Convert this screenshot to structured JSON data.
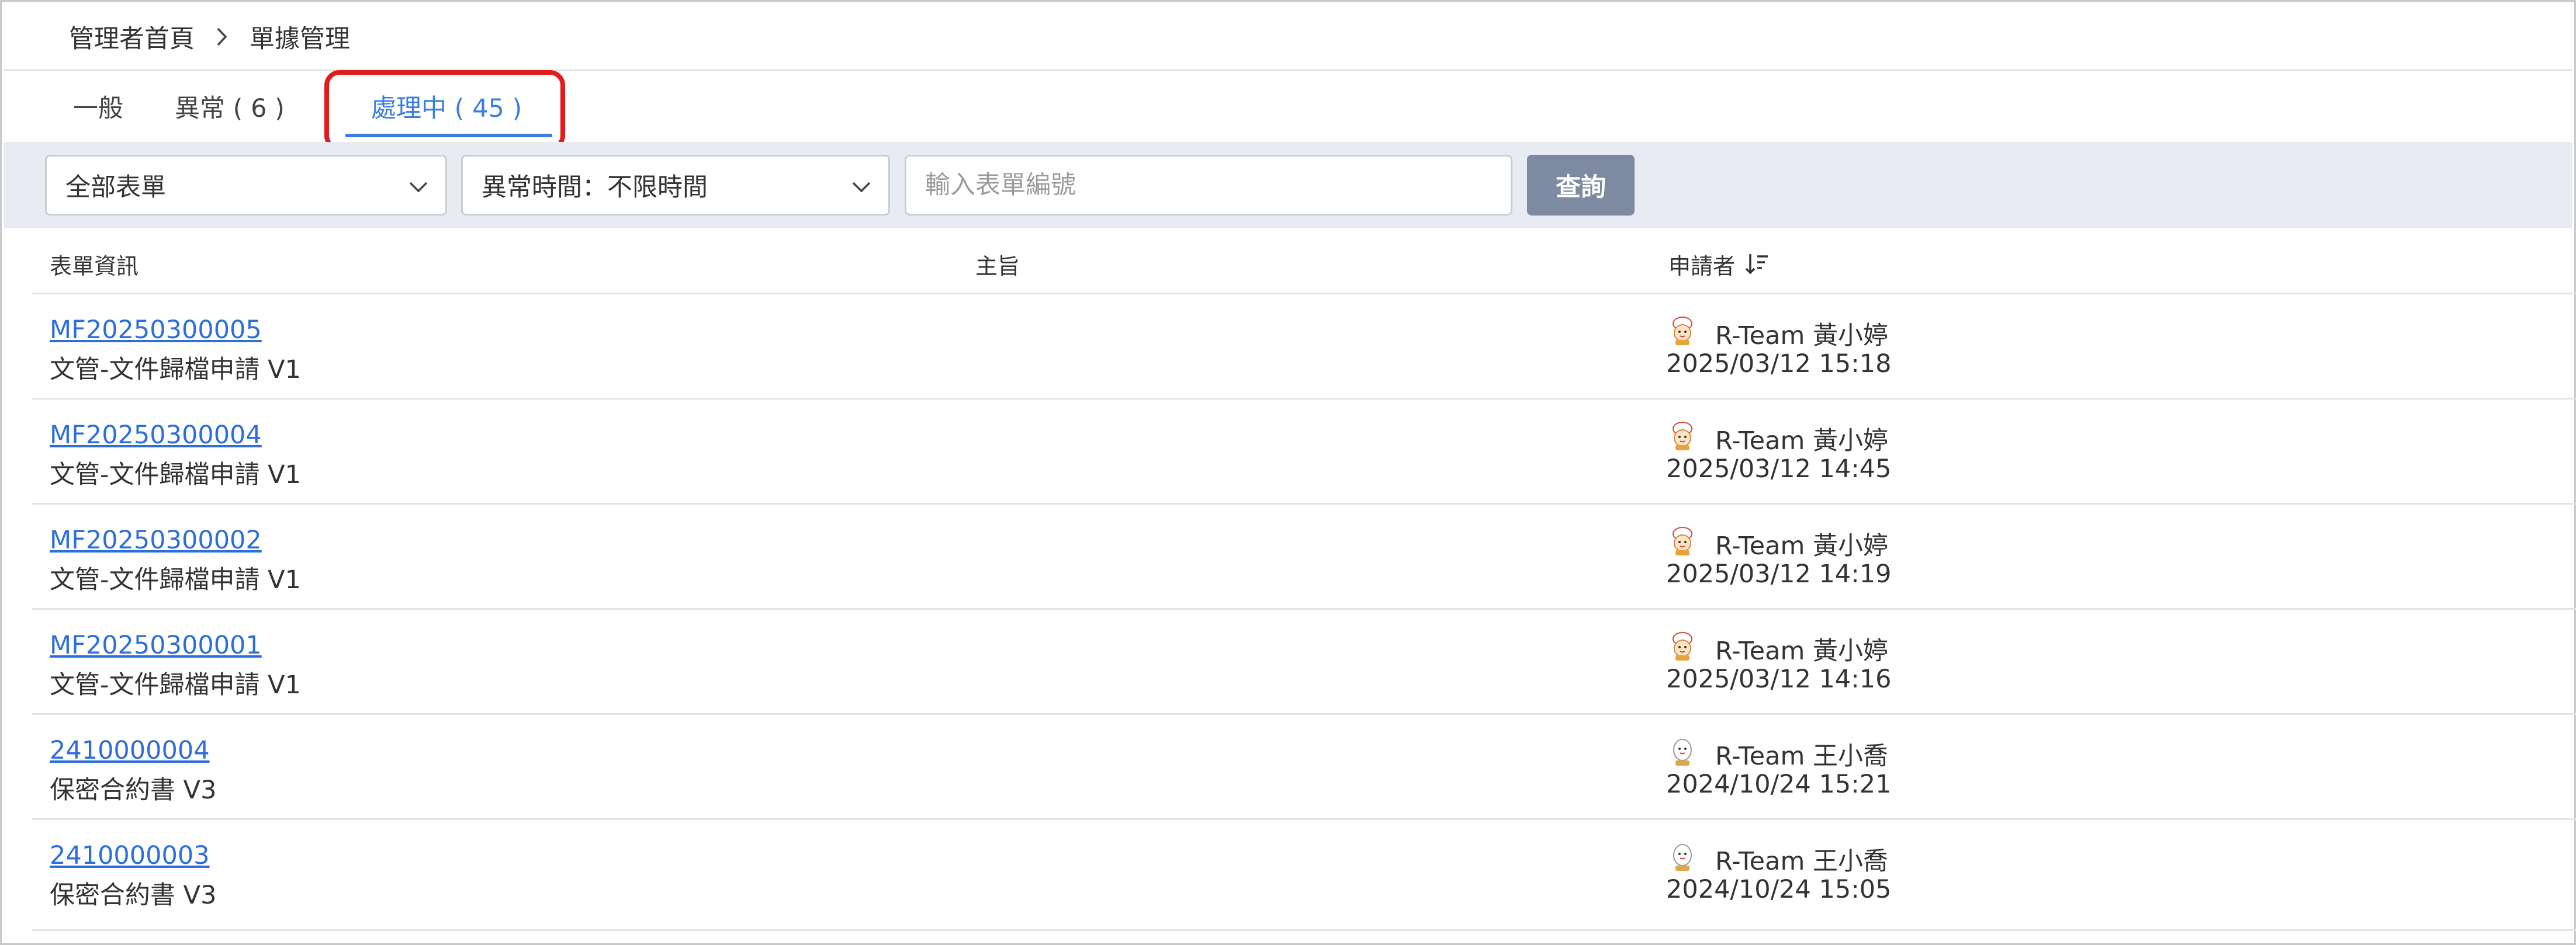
{
  "breadcrumb": {
    "home": "管理者首頁",
    "current": "單據管理"
  },
  "tabs": [
    {
      "label": "一般",
      "active": false
    },
    {
      "label": "異常 ( 6 )",
      "active": false
    },
    {
      "label": "處理中 ( 45 )",
      "active": true
    }
  ],
  "filters": {
    "form_type": "全部表單",
    "time_range": "異常時間：不限時間",
    "search_placeholder": "輸入表單編號",
    "query_label": "查詢"
  },
  "table": {
    "columns": [
      "表單資訊",
      "主旨",
      "申請者"
    ],
    "rows": [
      {
        "form_no": "MF20250300005",
        "form_name": "文管-文件歸檔申請 V1",
        "subject": "",
        "applicant": "R-Team 黃小婷",
        "datetime": "2025/03/12 15:18",
        "avatar": "chef-avatar-icon"
      },
      {
        "form_no": "MF20250300004",
        "form_name": "文管-文件歸檔申請 V1",
        "subject": "",
        "applicant": "R-Team 黃小婷",
        "datetime": "2025/03/12 14:45",
        "avatar": "chef-avatar-icon"
      },
      {
        "form_no": "MF20250300002",
        "form_name": "文管-文件歸檔申請 V1",
        "subject": "",
        "applicant": "R-Team 黃小婷",
        "datetime": "2025/03/12 14:19",
        "avatar": "chef-avatar-icon"
      },
      {
        "form_no": "MF20250300001",
        "form_name": "文管-文件歸檔申請 V1",
        "subject": "",
        "applicant": "R-Team 黃小婷",
        "datetime": "2025/03/12 14:16",
        "avatar": "chef-avatar-icon"
      },
      {
        "form_no": "2410000004",
        "form_name": "保密合約書 V3",
        "subject": "",
        "applicant": "R-Team 王小喬",
        "datetime": "2024/10/24 15:21",
        "avatar": "egg-avatar-icon"
      },
      {
        "form_no": "2410000003",
        "form_name": "保密合約書 V3",
        "subject": "",
        "applicant": "R-Team 王小喬",
        "datetime": "2024/10/24 15:05",
        "avatar": "egg-avatar-icon"
      }
    ]
  },
  "colors": {
    "accent": "#3d7de0",
    "link": "#2d6fd9",
    "highlight": "#e21b1b",
    "filter_bg": "#e8ecf2",
    "button": "#7d8aa1"
  }
}
